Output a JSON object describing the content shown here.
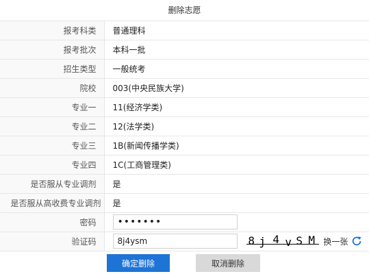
{
  "title": "删除志愿",
  "rows": [
    {
      "label": "报考科类",
      "value": "普通理科"
    },
    {
      "label": "报考批次",
      "value": "本科一批"
    },
    {
      "label": "招生类型",
      "value": "一般统考"
    },
    {
      "label": "院校",
      "value": "003(中央民族大学)"
    },
    {
      "label": "专业一",
      "value": "11(经济学类)"
    },
    {
      "label": "专业二",
      "value": "12(法学类)"
    },
    {
      "label": "专业三",
      "value": "1B(新闻传播学类)"
    },
    {
      "label": "专业四",
      "value": "1C(工商管理类)"
    },
    {
      "label": "是否服从专业调剂",
      "value": "是"
    },
    {
      "label": "是否服从高收费专业调剂",
      "value": "是"
    }
  ],
  "password": {
    "label": "密码",
    "value": "1234567"
  },
  "captcha": {
    "label": "验证码",
    "value": "8j4ysm",
    "image_chars": [
      "8",
      "j",
      "4",
      "v",
      "S",
      "M"
    ],
    "refresh_label": "换一张",
    "refresh_icon": "refresh-icon"
  },
  "buttons": {
    "confirm": "确定删除",
    "cancel": "取消删除"
  },
  "colors": {
    "confirm_bg": "#1e74d6",
    "cancel_bg": "#d9d9d9",
    "refresh_icon": "#1e74d6"
  }
}
